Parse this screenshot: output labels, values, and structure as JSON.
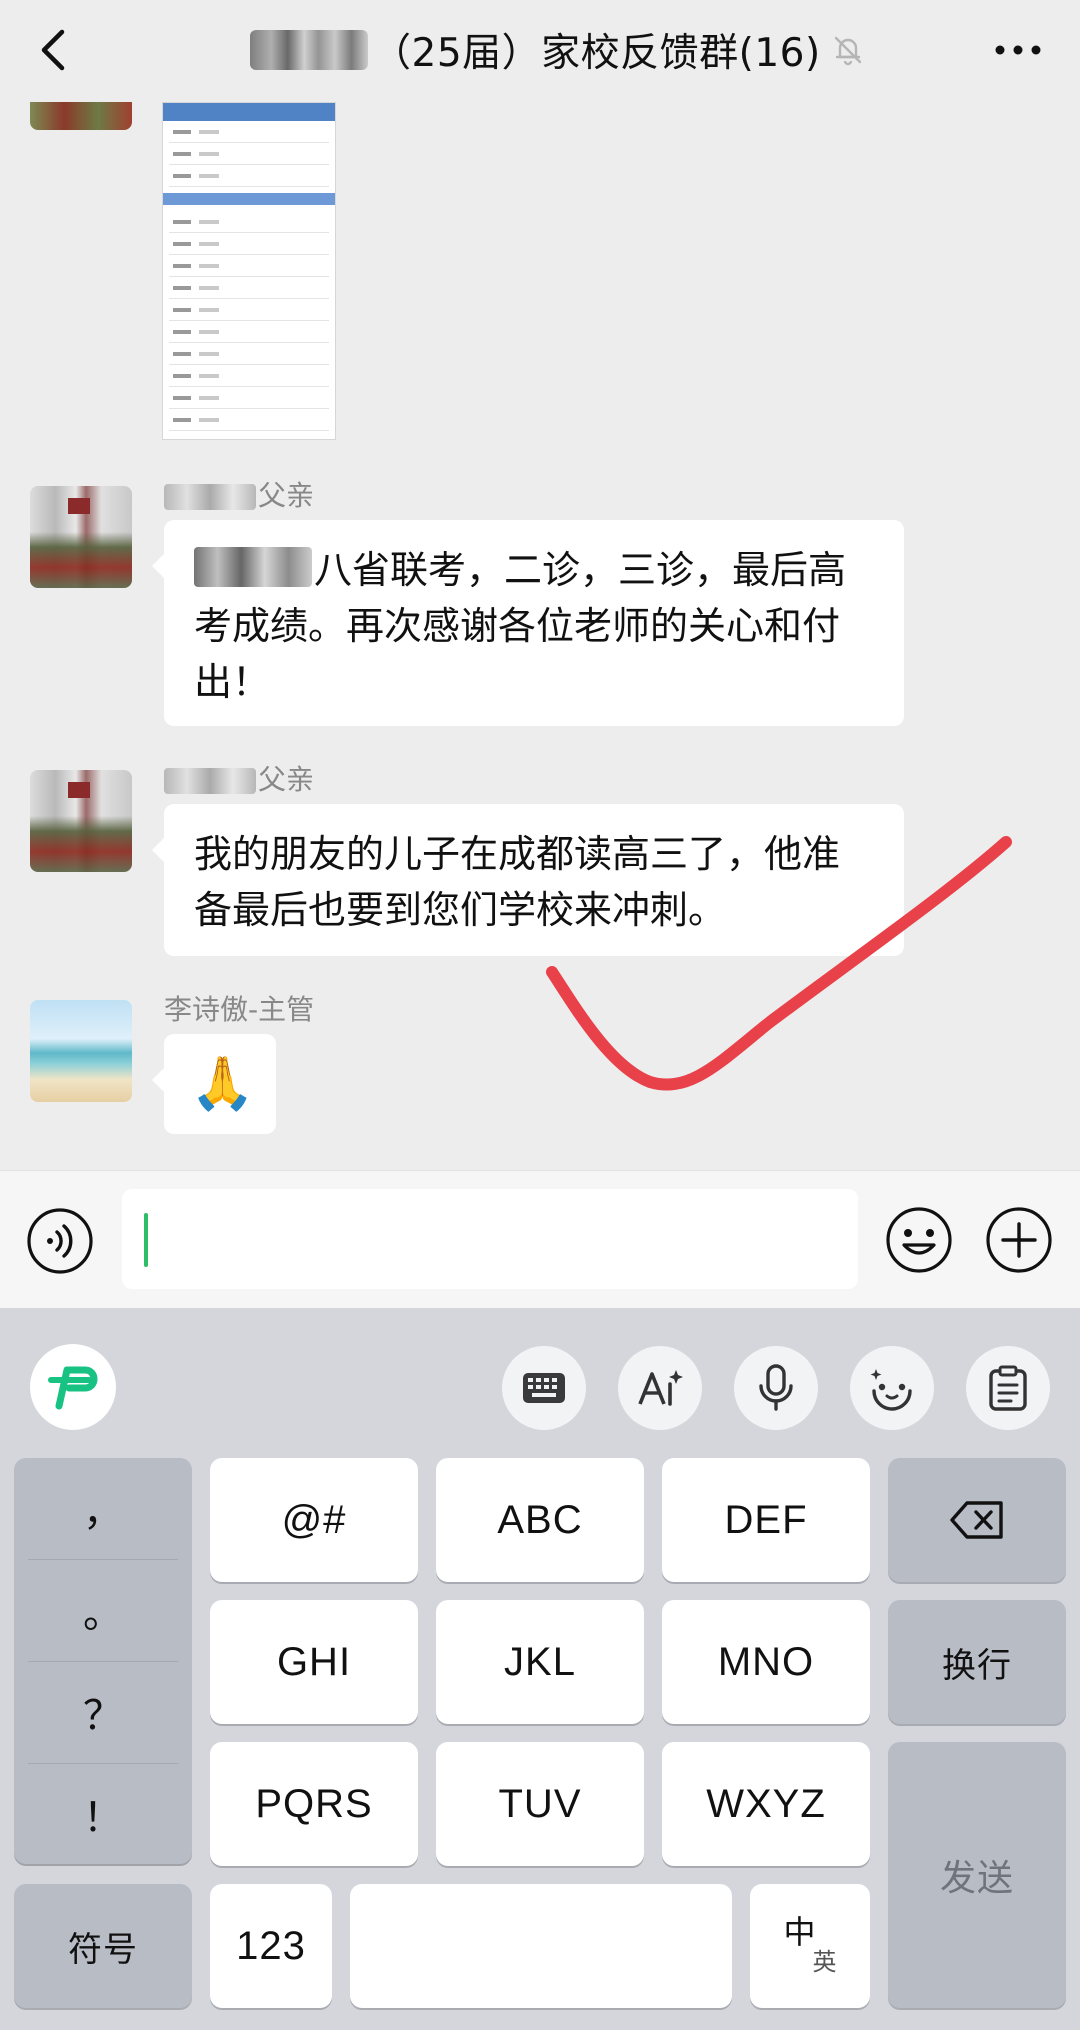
{
  "header": {
    "title": "（25届）家校反馈群(16)",
    "more_label": "•••"
  },
  "messages": [
    {
      "sender_suffix": "父亲",
      "text_prefix": "",
      "text": "八省联考，二诊，三诊，最后高考成绩。再次感谢各位老师的关心和付出！"
    },
    {
      "sender_suffix": "父亲",
      "text": "我的朋友的儿子在成都读高三了，他准备最后也要到您们学校来冲刺。"
    },
    {
      "sender": "李诗傲-主管",
      "text": "🙏"
    }
  ],
  "input": {
    "value": "",
    "placeholder": ""
  },
  "keyboard": {
    "punct": [
      "，",
      "。",
      "？",
      "！"
    ],
    "rows": [
      [
        "@#",
        "ABC",
        "DEF"
      ],
      [
        "GHI",
        "JKL",
        "MNO"
      ],
      [
        "PQRS",
        "TUV",
        "WXYZ"
      ]
    ],
    "newline_label": "换行",
    "send_label": "发送",
    "symbols_label": "符号",
    "numbers_label": "123",
    "zh_label": "中",
    "en_label": "英"
  },
  "colors": {
    "accent_green": "#2dbf68",
    "annotation_red": "#e8414a",
    "logo_green": "#17c283"
  }
}
